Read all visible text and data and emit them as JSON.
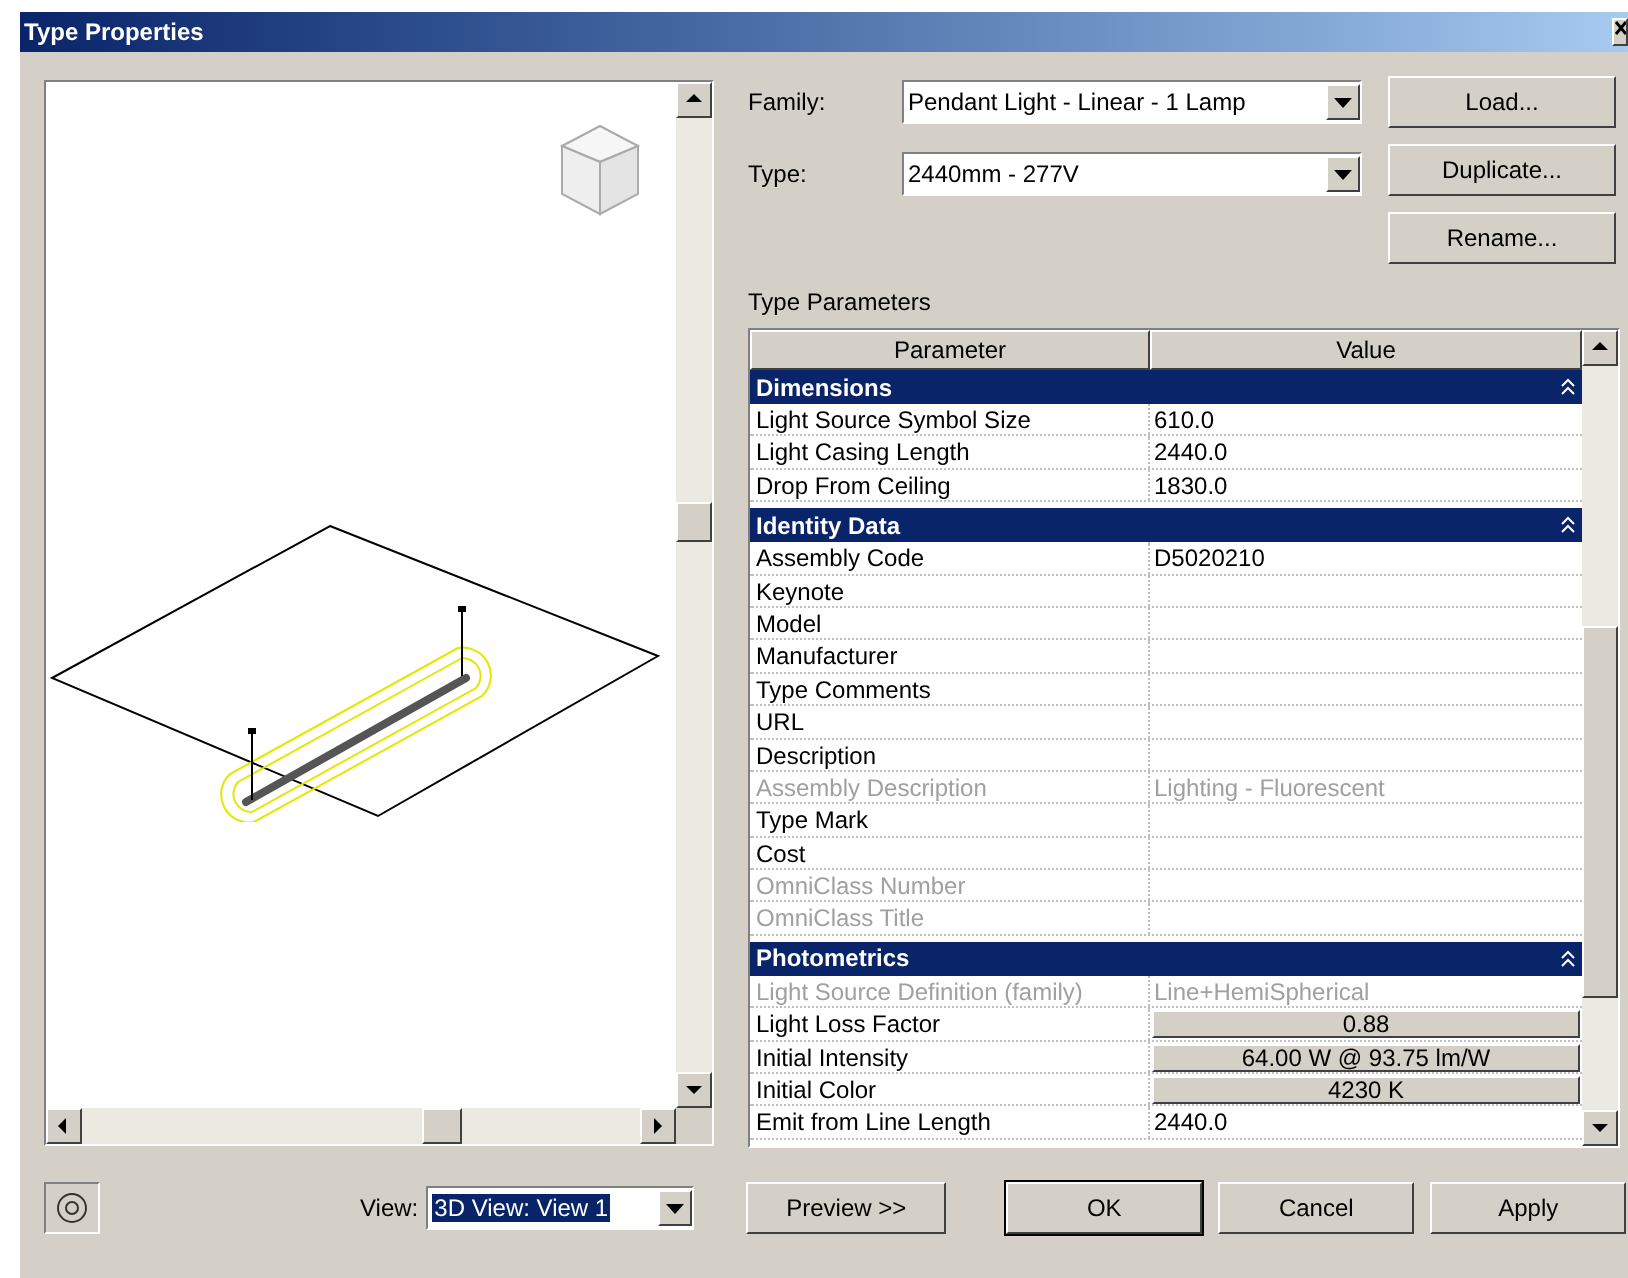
{
  "window": {
    "title": "Type Properties"
  },
  "family": {
    "label": "Family:",
    "value": "Pendant Light - Linear - 1 Lamp"
  },
  "type": {
    "label": "Type:",
    "value": "2440mm - 277V"
  },
  "side_buttons": [
    "Load...",
    "Duplicate...",
    "Rename..."
  ],
  "type_parameters": {
    "title": "Type Parameters",
    "columns": [
      "Parameter",
      "Value"
    ],
    "rows": [
      {
        "kind": "group",
        "label": "Dimensions",
        "expanded": true
      },
      {
        "kind": "text",
        "label": "Light Source Symbol Size",
        "value": "610.0",
        "disabled": false
      },
      {
        "kind": "text",
        "label": "Light Casing Length",
        "value": "2440.0",
        "disabled": false
      },
      {
        "kind": "text",
        "label": "Drop From Ceiling",
        "value": "1830.0",
        "disabled": false
      },
      {
        "kind": "group",
        "label": "Identity Data",
        "expanded": true
      },
      {
        "kind": "text",
        "label": "Assembly Code",
        "value": "D5020210",
        "disabled": false
      },
      {
        "kind": "text",
        "label": "Keynote",
        "disabled": false
      },
      {
        "kind": "text",
        "label": "Model",
        "disabled": false
      },
      {
        "kind": "text",
        "label": "Manufacturer",
        "disabled": false
      },
      {
        "kind": "text",
        "label": "Type Comments",
        "disabled": false
      },
      {
        "kind": "text",
        "label": "URL",
        "disabled": false
      },
      {
        "kind": "text",
        "label": "Description",
        "disabled": false
      },
      {
        "kind": "text",
        "label": "Assembly Description",
        "value": "Lighting - Fluorescent",
        "disabled": true
      },
      {
        "kind": "text",
        "label": "Type Mark",
        "disabled": false
      },
      {
        "kind": "text",
        "label": "Cost",
        "disabled": false
      },
      {
        "kind": "text",
        "label": "OmniClass Number",
        "disabled": true
      },
      {
        "kind": "text",
        "label": "OmniClass Title",
        "disabled": true
      },
      {
        "kind": "group",
        "label": "Photometrics",
        "expanded": true
      },
      {
        "kind": "text",
        "label": "Light Source Definition (family)",
        "value": "Line+HemiSpherical",
        "disabled": true
      },
      {
        "kind": "button",
        "label": "Light Loss Factor",
        "value": "0.88",
        "disabled": false
      },
      {
        "kind": "button",
        "label": "Initial Intensity",
        "value": "64.00 W @ 93.75 lm/W",
        "disabled": false
      },
      {
        "kind": "button",
        "label": "Initial Color",
        "value": "4230 K",
        "disabled": false
      },
      {
        "kind": "text",
        "label": "Emit from Line Length",
        "value": "2440.0",
        "disabled": false
      }
    ]
  },
  "view": {
    "label": "View:",
    "value": "3D View: View 1"
  },
  "bottom_buttons": [
    {
      "label": "Preview >>",
      "default": false
    },
    {
      "label": "OK",
      "default": true
    },
    {
      "label": "Cancel",
      "default": false
    },
    {
      "label": "Apply",
      "default": false
    }
  ]
}
